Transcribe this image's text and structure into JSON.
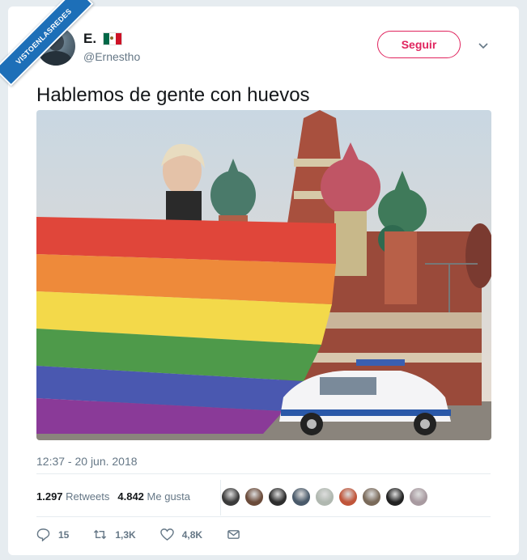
{
  "watermark": {
    "text": "VISTOENLASREDES"
  },
  "user": {
    "name": "E.",
    "handle": "@Ernestho",
    "flag_icon": "mexico-flag-icon"
  },
  "follow_button": {
    "label": "Seguir",
    "color": "#e0245e"
  },
  "tweet": {
    "text": "Hablemos de gente con huevos",
    "timestamp": "12:37 - 20 jun. 2018"
  },
  "stats": {
    "retweets_count": "1.297",
    "retweets_label": "Retweets",
    "likes_count": "4.842",
    "likes_label": "Me gusta"
  },
  "actions": {
    "replies": "15",
    "retweets": "1,3K",
    "likes": "4,8K"
  },
  "liker_avatars": [
    "#3b3b3b",
    "#6b4b3a",
    "#2e2e2e",
    "#4a5a6a",
    "#b0b8b0",
    "#c0553a",
    "#7a6a5a",
    "#222222",
    "#a89aa0"
  ]
}
